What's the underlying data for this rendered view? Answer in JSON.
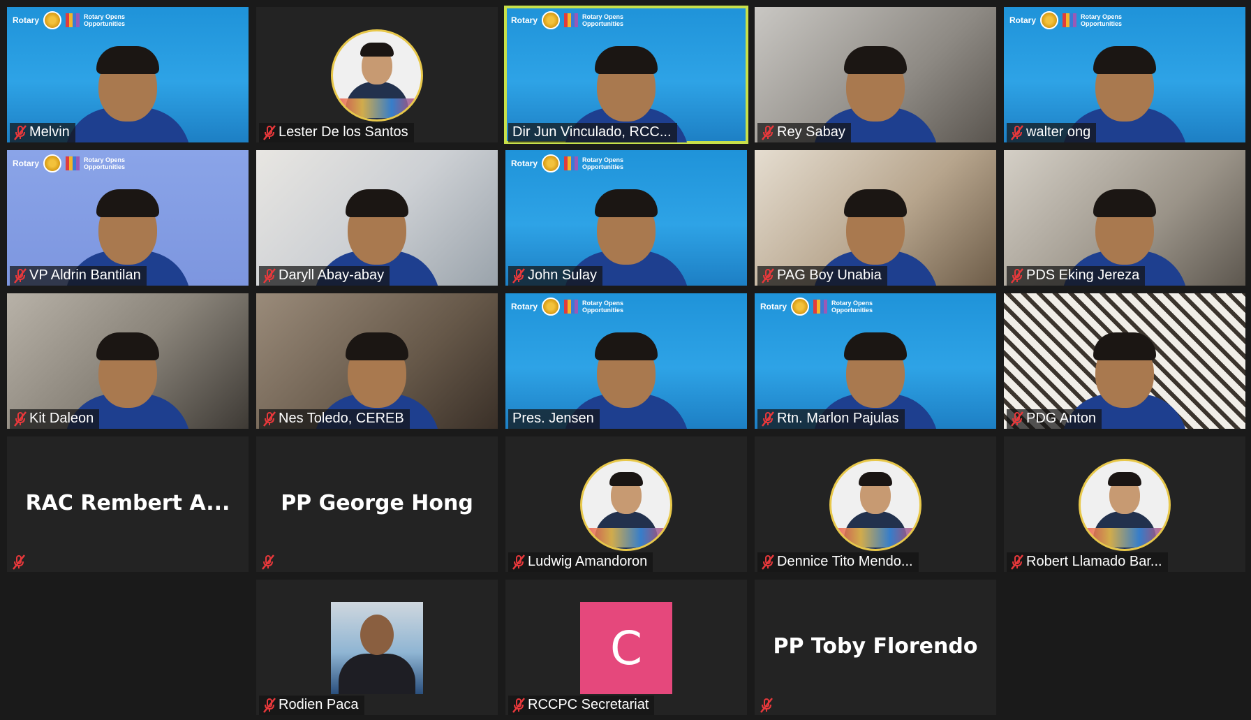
{
  "participants": [
    {
      "name": "Melvin",
      "muted": true,
      "bg": "rotary",
      "video": true
    },
    {
      "name": "Lester De los Santos",
      "muted": true,
      "bg": "avatar",
      "video": false
    },
    {
      "name": "Dir Jun Vinculado, RCC...",
      "muted": false,
      "bg": "rotary",
      "video": true,
      "active": true
    },
    {
      "name": "Rey Sabay",
      "muted": true,
      "bg": "room1",
      "video": true
    },
    {
      "name": "walter ong",
      "muted": true,
      "bg": "rotary",
      "video": true
    },
    {
      "name": "VP Aldrin Bantilan",
      "muted": true,
      "bg": "rotary-light",
      "video": true
    },
    {
      "name": "Daryll Abay-abay",
      "muted": true,
      "bg": "room2",
      "video": true
    },
    {
      "name": "John Sulay",
      "muted": true,
      "bg": "rotary",
      "video": true
    },
    {
      "name": "PAG Boy Unabia",
      "muted": true,
      "bg": "room3",
      "video": true
    },
    {
      "name": "PDS Eking Jereza",
      "muted": true,
      "bg": "room4",
      "video": true
    },
    {
      "name": "Kit Daleon",
      "muted": true,
      "bg": "room5",
      "video": true
    },
    {
      "name": "Nes Toledo, CEREB",
      "muted": true,
      "bg": "room6",
      "video": true
    },
    {
      "name": "Pres. Jensen",
      "muted": false,
      "bg": "rotary",
      "video": true
    },
    {
      "name": "Rtn. Marlon Pajulas",
      "muted": true,
      "bg": "rotary",
      "video": true
    },
    {
      "name": "PDG Anton",
      "muted": true,
      "bg": "lattice",
      "video": true
    },
    {
      "name": "RAC Rembert A...",
      "muted": true,
      "bg": "text",
      "video": false
    },
    {
      "name": "PP George Hong",
      "muted": true,
      "bg": "text",
      "video": false
    },
    {
      "name": "Ludwig Amandoron",
      "muted": true,
      "bg": "avatar",
      "video": false
    },
    {
      "name": "Dennice Tito Mendo...",
      "muted": true,
      "bg": "avatar",
      "video": false
    },
    {
      "name": "Robert Llamado Bar...",
      "muted": true,
      "bg": "avatar",
      "video": false
    },
    {
      "name": "Rodien Paca",
      "muted": true,
      "bg": "photo",
      "video": false
    },
    {
      "name": "RCCPC Secretariat",
      "muted": true,
      "bg": "letter",
      "letter": "C",
      "video": false
    },
    {
      "name": "PP Toby Florendo",
      "muted": true,
      "bg": "text",
      "video": false
    }
  ],
  "rotary_banner": {
    "brand": "Rotary",
    "tagline_1": "Rotary Opens",
    "tagline_2": "Opportunities"
  },
  "colors": {
    "active_outline": "#c8e04a",
    "mute_red": "#e8383b",
    "letter_avatar": "#e5487c",
    "tile_bg": "#232323"
  }
}
